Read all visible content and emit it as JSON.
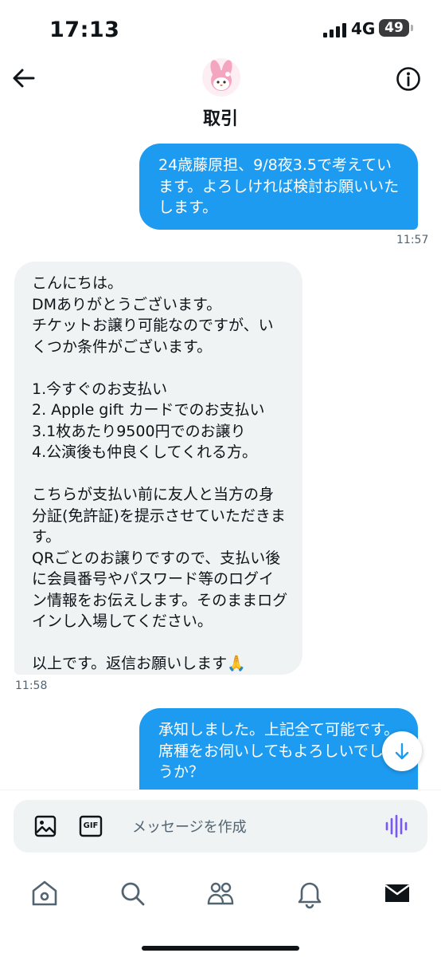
{
  "status_bar": {
    "time": "17:13",
    "network": "4G",
    "battery": "49"
  },
  "header": {
    "title": "取引"
  },
  "messages": [
    {
      "text": "24歳藤原担、9/8夜3.5で考えています。よろしければ検討お願いいたします。",
      "time": "11:57"
    },
    {
      "text": "こんにちは。\nDMありがとうございます。\nチケットお譲り可能なのですが、いくつか条件がございます。\n\n1.今すぐのお支払い\n2. Apple gift カードでのお支払い\n3.1枚あたり9500円でのお譲り\n4.公演後も仲良くしてくれる方。\n\nこちらが支払い前に友人と当方の身分証(免許証)を提示させていただきます。\nQRごとのお譲りですので、支払い後に会員番号やパスワード等のログイン情報をお伝えします。そのままログインし入場してください。\n\n以上です。返信お願いします🙏",
      "time": "11:58"
    },
    {
      "text": "承知しました。上記全て可能です。席種をお伺いしてもよろしいでしょうか？"
    }
  ],
  "composer": {
    "placeholder": "メッセージを作成",
    "gif_label": "GIF"
  },
  "colors": {
    "accent": "#1d9bf0",
    "incoming_bubble": "#eff3f4",
    "voice": "#7856ff"
  },
  "icons": [
    "back-arrow-icon",
    "info-icon",
    "image-icon",
    "gif-icon",
    "voice-wave-icon",
    "arrow-down-icon",
    "home-icon",
    "search-icon",
    "communities-icon",
    "bell-icon",
    "mail-icon"
  ]
}
